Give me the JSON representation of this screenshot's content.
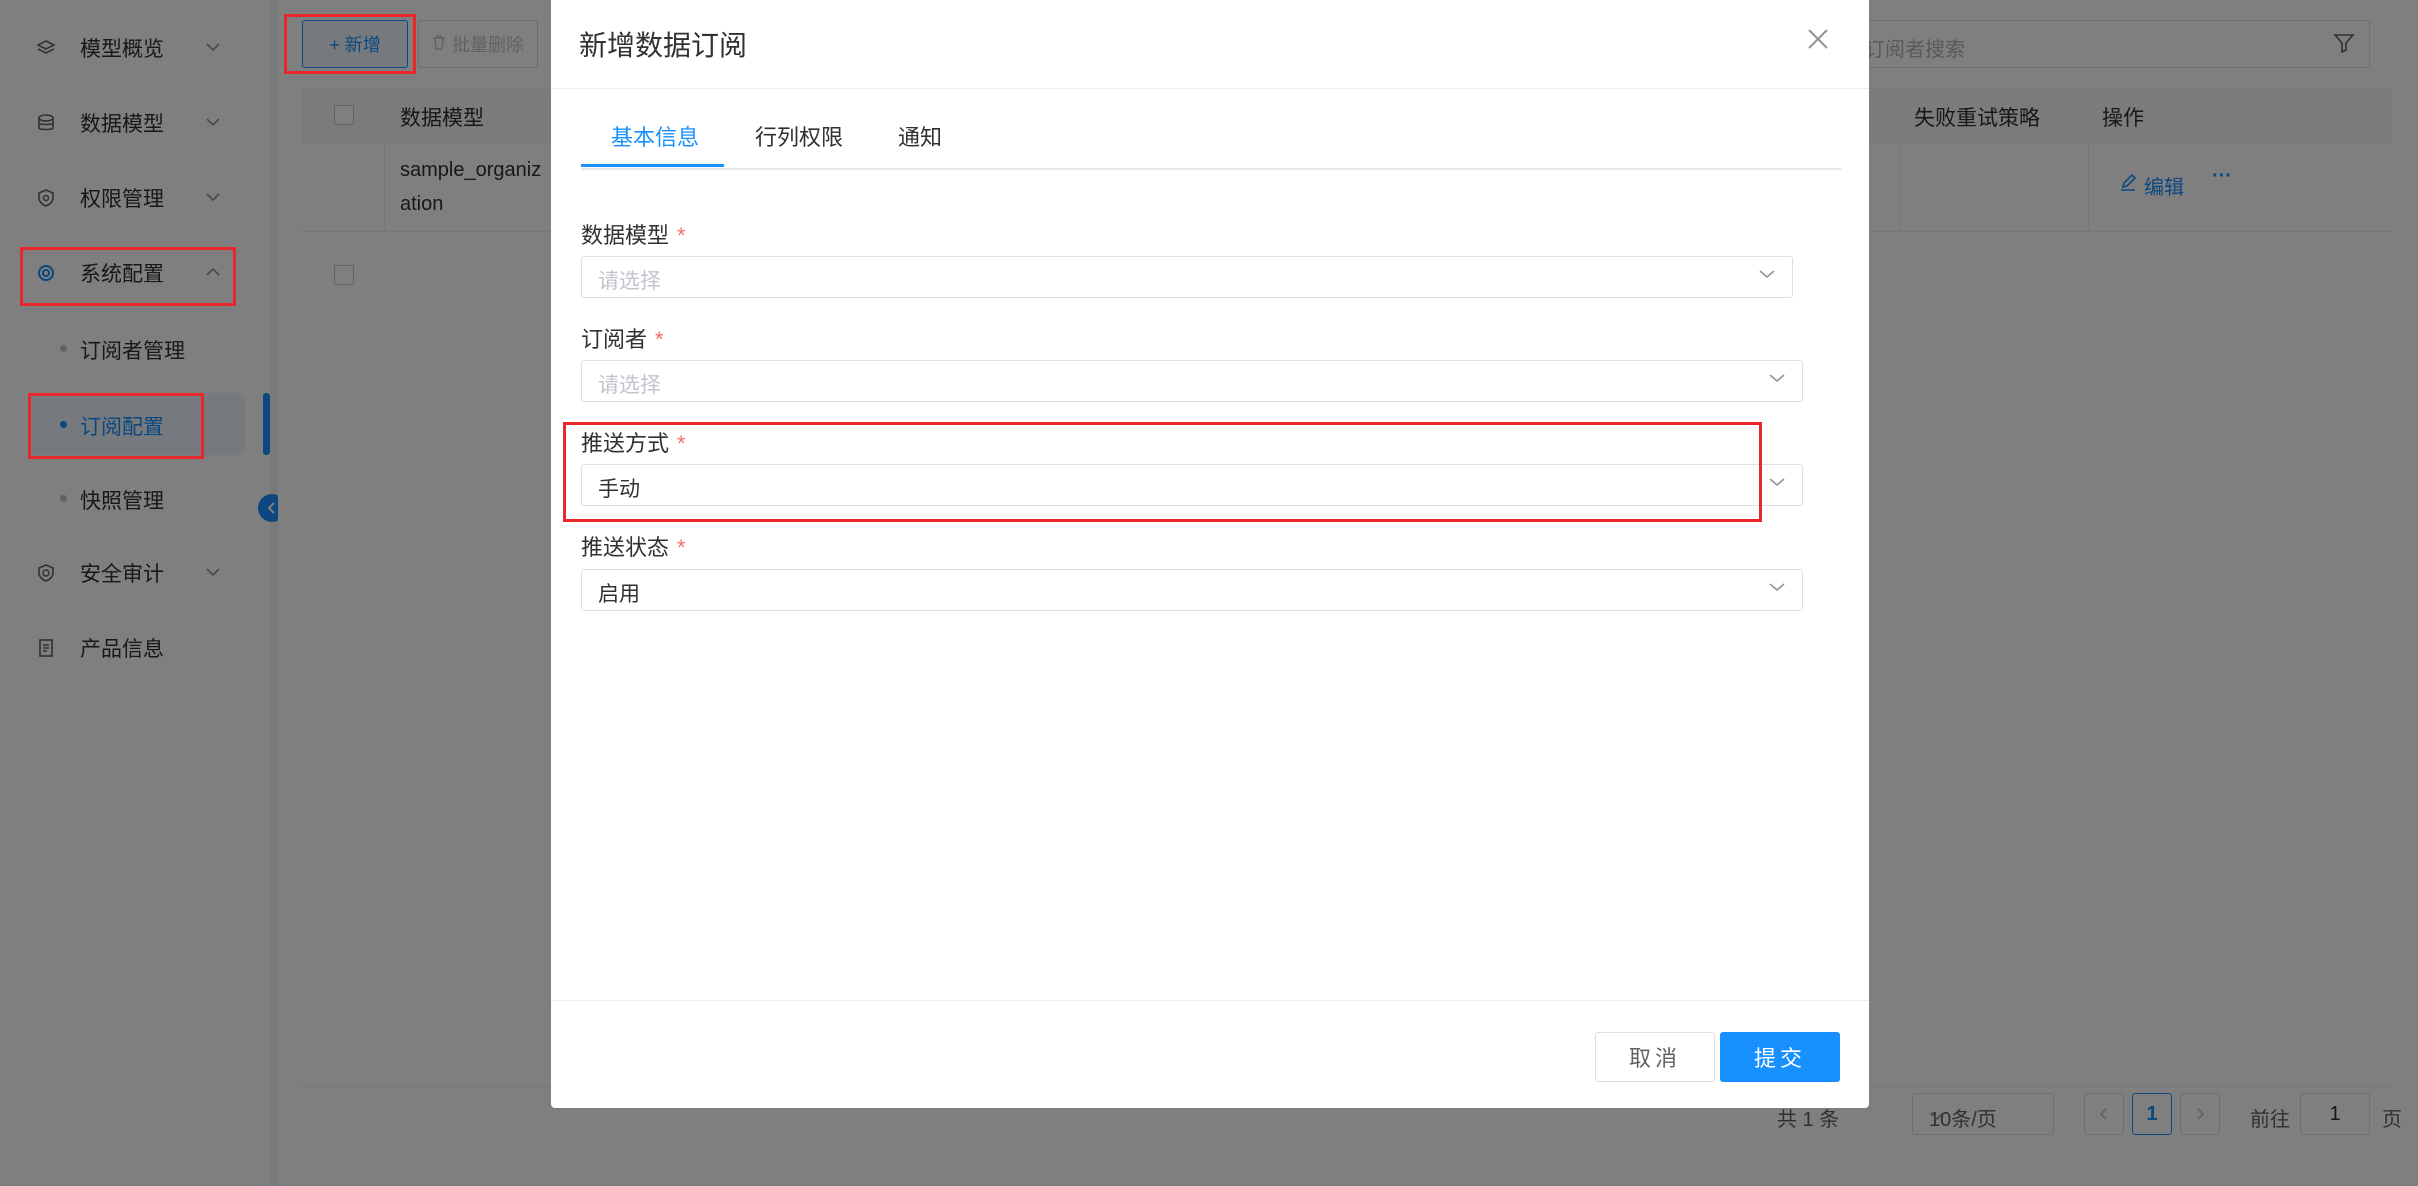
{
  "sidebar": {
    "items": [
      {
        "label": "模型概览",
        "icon": "layers-icon"
      },
      {
        "label": "数据模型",
        "icon": "database-icon"
      },
      {
        "label": "权限管理",
        "icon": "shield-icon"
      },
      {
        "label": "系统配置",
        "icon": "gear-icon"
      },
      {
        "label": "安全审计",
        "icon": "audit-icon"
      },
      {
        "label": "产品信息",
        "icon": "document-icon"
      }
    ],
    "sub_items": [
      {
        "label": "订阅者管理"
      },
      {
        "label": "订阅配置"
      },
      {
        "label": "快照管理"
      }
    ]
  },
  "toolbar": {
    "add_label": "+ 新增",
    "batch_delete_label": "批量删除",
    "search_placeholder": "择订阅者搜索"
  },
  "table": {
    "columns": [
      "数据模型",
      "失败重试策略",
      "操作"
    ],
    "rows": [
      {
        "model_line1": "sample_organiz",
        "model_line2": "ation",
        "edit_label": "编辑",
        "more_label": "···"
      }
    ]
  },
  "pagination": {
    "total": "共 1 条",
    "page_size": "10条/页",
    "current_page": "1",
    "goto_label": "前往",
    "goto_value": "1",
    "page_suffix": "页"
  },
  "modal": {
    "title": "新增数据订阅",
    "tabs": [
      "基本信息",
      "行列权限",
      "通知"
    ],
    "fields": [
      {
        "label": "数据模型",
        "required": "*",
        "value": "请选择"
      },
      {
        "label": "订阅者",
        "required": "*",
        "value": "请选择"
      },
      {
        "label": "推送方式",
        "required": "*",
        "value": "手动"
      },
      {
        "label": "推送状态",
        "required": "*",
        "value": "启用"
      }
    ],
    "cancel_label": "取消",
    "submit_label": "提交"
  },
  "colors": {
    "accent": "#1890ff",
    "highlight": "#e8272b",
    "required": "#f56c6c"
  }
}
